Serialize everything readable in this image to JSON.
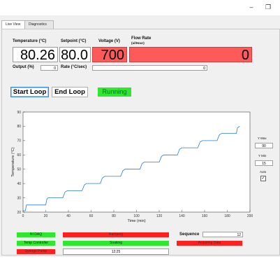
{
  "window": {
    "minimize_glyph": "–",
    "restore_glyph": "❐"
  },
  "tabs": [
    {
      "label": "Live View",
      "active": true
    },
    {
      "label": "Diagnostics",
      "active": false
    }
  ],
  "live": {
    "temperature_label": "Temperature (°C)",
    "temperature_value": "80.26",
    "setpoint_label": "Setpoint (°C)",
    "setpoint_value": "80.0",
    "voltage_label": "Voltage (V)",
    "voltage_value": "700",
    "flow_label": "Flow Rate",
    "flow_sublabel": "(ul/Hour)",
    "flow_value": "0",
    "output_label": "Output (%)",
    "output_value": "0",
    "rate_label": "Rate (°C/sec)",
    "rate_value": "0"
  },
  "controls": {
    "start_label": "Start Loop",
    "end_label": "End Loop",
    "status_label": "Running"
  },
  "scale": {
    "ymax_label": "Y Max",
    "ymax_value": "90",
    "ymin_label": "Y Min",
    "ymin_value": "15",
    "auto_label": "Auto",
    "auto_checked": true
  },
  "status": {
    "nidaq_label": "NI DAQ",
    "temp_controller_label": "Temp Controller",
    "syringe_pump_label": "Syringe Pump",
    "ramping_label": "Ramping",
    "soaking_label": "Soaking",
    "time_value": "12:25",
    "sequence_label": "Sequence",
    "sequence_value": "12",
    "acquiring_label": "Acquiring Data"
  },
  "colors": {
    "red": "#ff2020",
    "green": "#2ee82e",
    "line": "#2a7bd3",
    "big_red": "#ff5a5a"
  },
  "chart_data": {
    "type": "line",
    "xlabel": "Time (min)",
    "ylabel": "Temperature (°C)",
    "xlim": [
      0,
      200
    ],
    "ylim": [
      20,
      90
    ],
    "xticks": [
      0,
      20,
      40,
      60,
      80,
      100,
      120,
      140,
      160,
      180,
      200
    ],
    "yticks": [
      20,
      30,
      40,
      50,
      60,
      70,
      80,
      90
    ],
    "grid": false,
    "series": [
      {
        "color": "#2a7bd3",
        "x": [
          0,
          2,
          3,
          20,
          21,
          22,
          35,
          37,
          39,
          52,
          54,
          56,
          68,
          70,
          72,
          86,
          88,
          90,
          103,
          105,
          107,
          120,
          122,
          124,
          136,
          138,
          140,
          154,
          156,
          158,
          171,
          173,
          175,
          188,
          189,
          191
        ],
        "y": [
          21,
          21,
          25,
          25,
          29,
          30,
          30,
          34,
          35,
          35,
          39,
          40,
          40,
          44,
          45,
          45,
          49,
          50,
          50,
          54,
          55,
          55,
          59,
          60,
          60,
          64,
          65,
          65,
          69,
          70,
          70,
          74,
          75,
          75,
          79,
          80
        ]
      }
    ]
  }
}
